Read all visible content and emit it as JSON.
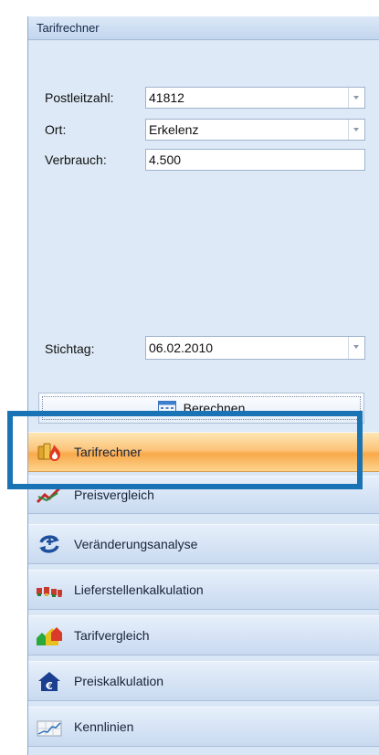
{
  "panel": {
    "title": "Tarifrechner"
  },
  "form": {
    "postleitzahl": {
      "label": "Postleitzahl:",
      "value": "41812"
    },
    "ort": {
      "label": "Ort:",
      "value": "Erkelenz"
    },
    "verbrauch": {
      "label": "Verbrauch:",
      "value": "4.500"
    },
    "stichtag": {
      "label": "Stichtag:",
      "value": "06.02.2010"
    },
    "berechnen_label": "Berechnen"
  },
  "nav": {
    "items": [
      {
        "label": "Tarifrechner",
        "icon": "tarifrechner-icon",
        "active": true
      },
      {
        "label": "Preisvergleich",
        "icon": "preisvergleich-icon"
      },
      {
        "label": "Veränderungsanalyse",
        "icon": "veraenderungsanalyse-icon"
      },
      {
        "label": "Lieferstellenkalkulation",
        "icon": "lieferstellenkalkulation-icon"
      },
      {
        "label": "Tarifvergleich",
        "icon": "tarifvergleich-icon"
      },
      {
        "label": "Preiskalkulation",
        "icon": "preiskalkulation-icon"
      },
      {
        "label": "Kennlinien",
        "icon": "kennlinien-icon"
      }
    ]
  },
  "colors": {
    "accent_highlight": "#1a73b5",
    "active_item": "#fcc47a",
    "panel_bg": "#d9e6f5"
  }
}
